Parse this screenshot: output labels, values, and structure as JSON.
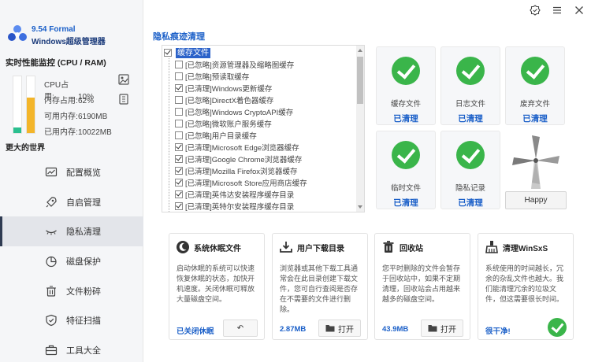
{
  "app": {
    "version": "9.54 Formal",
    "name": "Windows超级管理器",
    "accent_color": "#1a5fc8"
  },
  "perf": {
    "title": "实时性能监控 (CPU / RAM)",
    "cpu": {
      "label": "CPU占用:",
      "value": "10%",
      "level": 0.1
    },
    "mem": {
      "label": "内存占用:",
      "value": "62%",
      "level": 0.62
    },
    "mem_free": {
      "label": "可用内存:",
      "value": "6190MB"
    },
    "mem_used": {
      "label": "已用内存:",
      "value": "10022MB"
    }
  },
  "tagline": "更大的世界",
  "nav": [
    {
      "label": "配置概览",
      "icon": "chart-icon"
    },
    {
      "label": "自启管理",
      "icon": "rocket-icon"
    },
    {
      "label": "隐私清理",
      "icon": "eye-closed-icon",
      "active": true
    },
    {
      "label": "磁盘保护",
      "icon": "pie-icon"
    },
    {
      "label": "文件粉碎",
      "icon": "trash-icon"
    },
    {
      "label": "特征扫描",
      "icon": "shield-icon"
    },
    {
      "label": "工具大全",
      "icon": "briefcase-icon"
    }
  ],
  "main": {
    "title": "隐私痕迹清理",
    "tree_root": "缓存文件",
    "tree_items": [
      {
        "label": "[已忽略]资源管理器及缩略图缓存",
        "checked": false
      },
      {
        "label": "[已忽略]预读取缓存",
        "checked": false
      },
      {
        "label": "[已清理]Windows更新缓存",
        "checked": true
      },
      {
        "label": "[已忽略]DirectX着色器缓存",
        "checked": false
      },
      {
        "label": "[已忽略]Windows CryptoAPI缓存",
        "checked": false
      },
      {
        "label": "[已忽略]微软账户服务缓存",
        "checked": false
      },
      {
        "label": "[已忽略]用户目录缓存",
        "checked": false
      },
      {
        "label": "[已清理]Microsoft Edge浏览器缓存",
        "checked": true
      },
      {
        "label": "[已清理]Google Chrome浏览器缓存",
        "checked": true
      },
      {
        "label": "[已清理]Mozilla Firefox浏览器缓存",
        "checked": true
      },
      {
        "label": "[已清理]Microsoft Store应用商店缓存",
        "checked": true
      },
      {
        "label": "[已清理]英伟达安装程序缓存目录",
        "checked": true
      },
      {
        "label": "[已清理]英特尔安装程序缓存目录",
        "checked": true
      }
    ]
  },
  "cards": [
    {
      "name": "缓存文件",
      "status": "已清理"
    },
    {
      "name": "日志文件",
      "status": "已清理"
    },
    {
      "name": "废弃文件",
      "status": "已清理"
    },
    {
      "name": "临时文件",
      "status": "已清理"
    },
    {
      "name": "隐私记录",
      "status": "已清理"
    }
  ],
  "happy_label": "Happy",
  "panels": [
    {
      "title": "系统休眠文件",
      "desc": "启动休眠的系统可以快速恢复休眠的状态，加快开机速度。关闭休眠可释放大量磁盘空间。",
      "value": "已关闭休眠",
      "button": "↶"
    },
    {
      "title": "用户下载目录",
      "desc": "浏览器或其他下载工具通常会在此目录创建下载文件，您可自行查阅是否存在不需要的文件进行删除。",
      "value": "2.87MB",
      "button": "打开"
    },
    {
      "title": "回收站",
      "desc": "您平时删除的文件会暂存于回收站中，如果不定期清理，回收站会占用越来越多的磁盘空间。",
      "value": "43.9MB",
      "button": "打开"
    },
    {
      "title": "清理WinSxS",
      "desc": "系统使用的时间越长，冗余的杂乱文件也越大。我们能清理冗余的垃圾文件，但这需要很长时间。",
      "value": "很干净!"
    }
  ]
}
